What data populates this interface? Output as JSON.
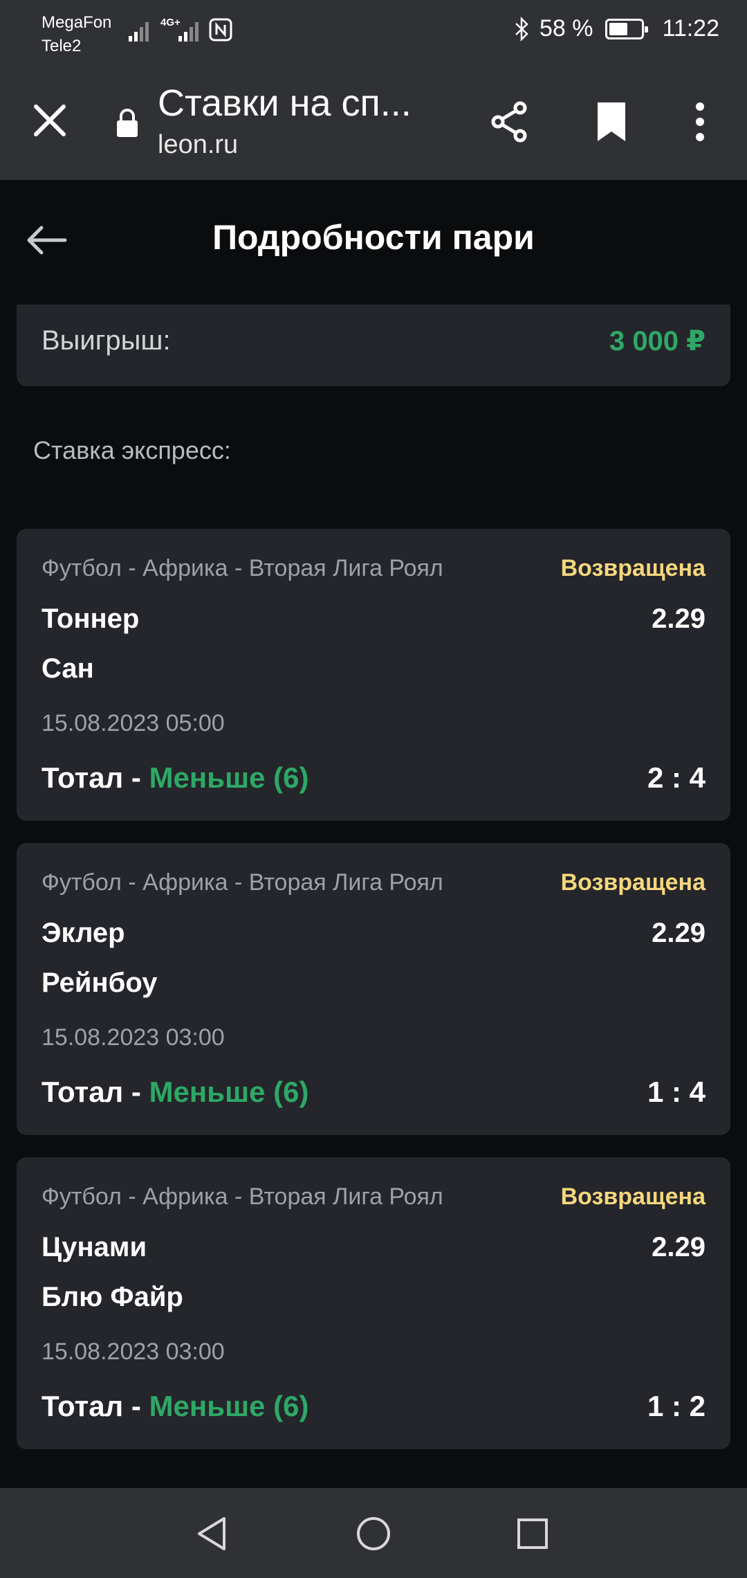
{
  "status_bar": {
    "carrier1": "MegaFon",
    "carrier2": "Tele2",
    "network_label": "4G+",
    "battery_text": "58 %",
    "battery_level": 0.58,
    "time": "11:22"
  },
  "browser": {
    "page_title": "Ставки на сп...",
    "host": "leon.ru"
  },
  "page": {
    "title": "Подробности пари",
    "win_label": "Выигрыш:",
    "win_value": "3 000 ₽",
    "section_label": "Ставка экспресс:"
  },
  "bets": [
    {
      "league": "Футбол - Африка - Вторая Лига Роял",
      "status": "Возвращена",
      "team1": "Тоннер",
      "team2": "Сан",
      "odds": "2.29",
      "date": "15.08.2023 05:00",
      "market_prefix": "Тотал - ",
      "market_pick": "Меньше (6)",
      "score": "2 : 4"
    },
    {
      "league": "Футбол - Африка - Вторая Лига Роял",
      "status": "Возвращена",
      "team1": "Эклер",
      "team2": "Рейнбоу",
      "odds": "2.29",
      "date": "15.08.2023 03:00",
      "market_prefix": "Тотал - ",
      "market_pick": "Меньше (6)",
      "score": "1 : 4"
    },
    {
      "league": "Футбол - Африка - Вторая Лига Роял",
      "status": "Возвращена",
      "team1": "Цунами",
      "team2": "Блю Файр",
      "odds": "2.29",
      "date": "15.08.2023 03:00",
      "market_prefix": "Тотал - ",
      "market_pick": "Меньше (6)",
      "score": "1 : 2"
    }
  ],
  "colors": {
    "accent_green": "#2ea866",
    "status_yellow": "#f6d77d",
    "card_bg": "#24262b",
    "page_bg": "#0b0c0e",
    "bar_bg": "#303134"
  }
}
